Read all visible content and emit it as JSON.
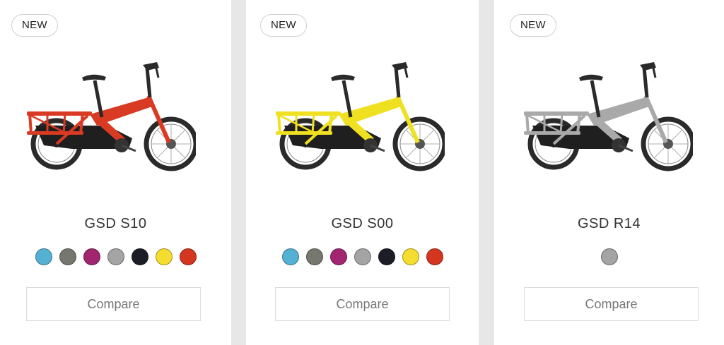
{
  "products": [
    {
      "badge": "NEW",
      "name": "GSD S10",
      "frame_color": "#d93a24",
      "swatches": [
        "#55b1d3",
        "#76786f",
        "#a1266f",
        "#a4a4a4",
        "#1c1d26",
        "#f5dd30",
        "#d5361f"
      ],
      "compare_label": "Compare"
    },
    {
      "badge": "NEW",
      "name": "GSD S00",
      "frame_color": "#f0e022",
      "swatches": [
        "#55b1d3",
        "#76786f",
        "#a1266f",
        "#a4a4a4",
        "#1c1d26",
        "#f5dd30",
        "#d5361f"
      ],
      "compare_label": "Compare"
    },
    {
      "badge": "NEW",
      "name": "GSD R14",
      "frame_color": "#a9a9a9",
      "swatches": [
        "#a4a4a4"
      ],
      "compare_label": "Compare"
    }
  ]
}
